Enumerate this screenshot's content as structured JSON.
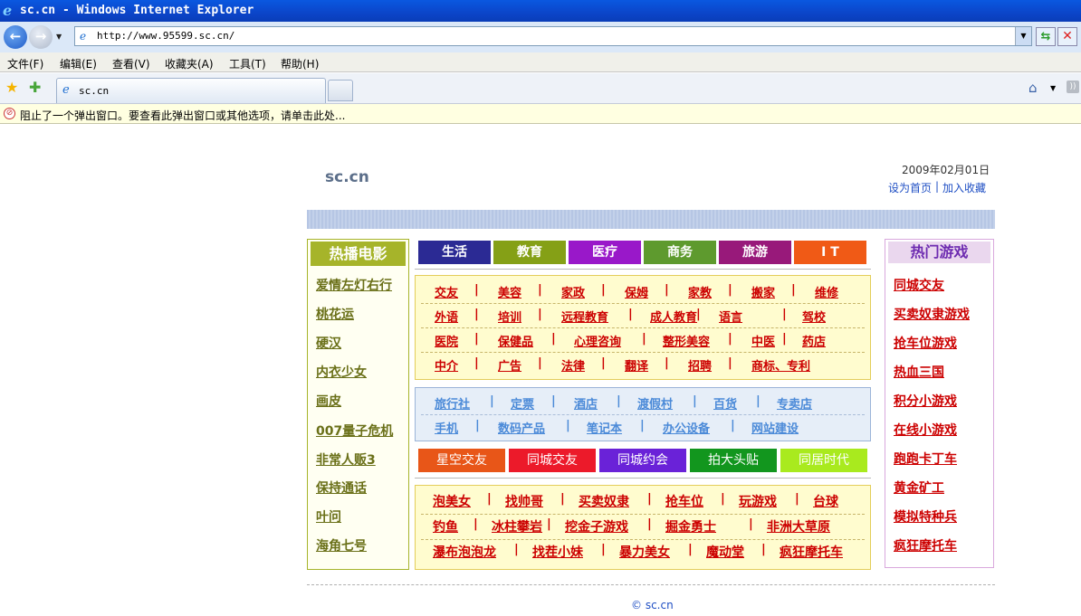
{
  "window": {
    "title": "sc.cn - Windows Internet Explorer",
    "url": "http://www.95599.sc.cn/"
  },
  "menu": [
    "文件(F)",
    "编辑(E)",
    "查看(V)",
    "收藏夹(A)",
    "工具(T)",
    "帮助(H)"
  ],
  "tab": {
    "label": "sc.cn"
  },
  "infobar": {
    "text": "阻止了一个弹出窗口。要查看此弹出窗口或其他选项，请单击此处..."
  },
  "header": {
    "logo": "sc.cn",
    "date": "2009年02月01日",
    "set_home": "设为首页",
    "sep": "|",
    "add_fav": "加入收藏"
  },
  "movies": {
    "title": "热播电影",
    "items": [
      "爱情左灯右行",
      "桃花运",
      "硬汉",
      "内衣少女",
      "画皮",
      "007量子危机",
      "非常人贩3",
      "保持通话",
      "叶问",
      "海角七号"
    ]
  },
  "games": {
    "title": "热门游戏",
    "items": [
      "同城交友",
      "买卖奴隶游戏",
      "抢车位游戏",
      "热血三国",
      "积分小游戏",
      "在线小游戏",
      "跑跑卡丁车",
      "黄金矿工",
      "模拟特种兵",
      "疯狂摩托车"
    ]
  },
  "categories": [
    {
      "label": "生活",
      "color": "#2b2a94"
    },
    {
      "label": "教育",
      "color": "#85a016"
    },
    {
      "label": "医疗",
      "color": "#9918c9"
    },
    {
      "label": "商务",
      "color": "#5e9a2e"
    },
    {
      "label": "旅游",
      "color": "#98197a"
    },
    {
      "label": "I T",
      "color": "#f05a16"
    }
  ],
  "box1": [
    [
      "交友",
      "美容",
      "家政",
      "保姆",
      "家教",
      "搬家",
      "维修"
    ],
    [
      "外语",
      "培训",
      "远程教育",
      "成人教育",
      "语言",
      "驾校"
    ],
    [
      "医院",
      "保健品",
      "心理咨询",
      "整形美容",
      "中医",
      "药店"
    ],
    [
      "中介",
      "广告",
      "法律",
      "翻译",
      "招聘",
      "商标、专利"
    ]
  ],
  "box2": [
    [
      "旅行社",
      "定票",
      "酒店",
      "渡假村",
      "百货",
      "专卖店"
    ],
    [
      "手机",
      "数码产品",
      "笔记本",
      "办公设备",
      "网站建设"
    ]
  ],
  "chips": [
    {
      "label": "星空交友",
      "color": "#e85618"
    },
    {
      "label": "同城交友",
      "color": "#ec1a2a"
    },
    {
      "label": "同城约会",
      "color": "#6a22d8"
    },
    {
      "label": "拍大头贴",
      "color": "#12961e"
    },
    {
      "label": "同居时代",
      "color": "#a9ea1e"
    }
  ],
  "box3": [
    [
      "泡美女",
      "找帅哥",
      "买卖奴隶",
      "抢车位",
      "玩游戏",
      "台球"
    ],
    [
      "钓鱼",
      "冰柱攀岩",
      "挖金子游戏",
      "掘金勇士",
      "非洲大草原"
    ],
    [
      "瀑布泡泡龙",
      "找茬小妹",
      "暴力美女",
      "魔动堂",
      "疯狂摩托车"
    ]
  ],
  "footer": "© sc.cn"
}
